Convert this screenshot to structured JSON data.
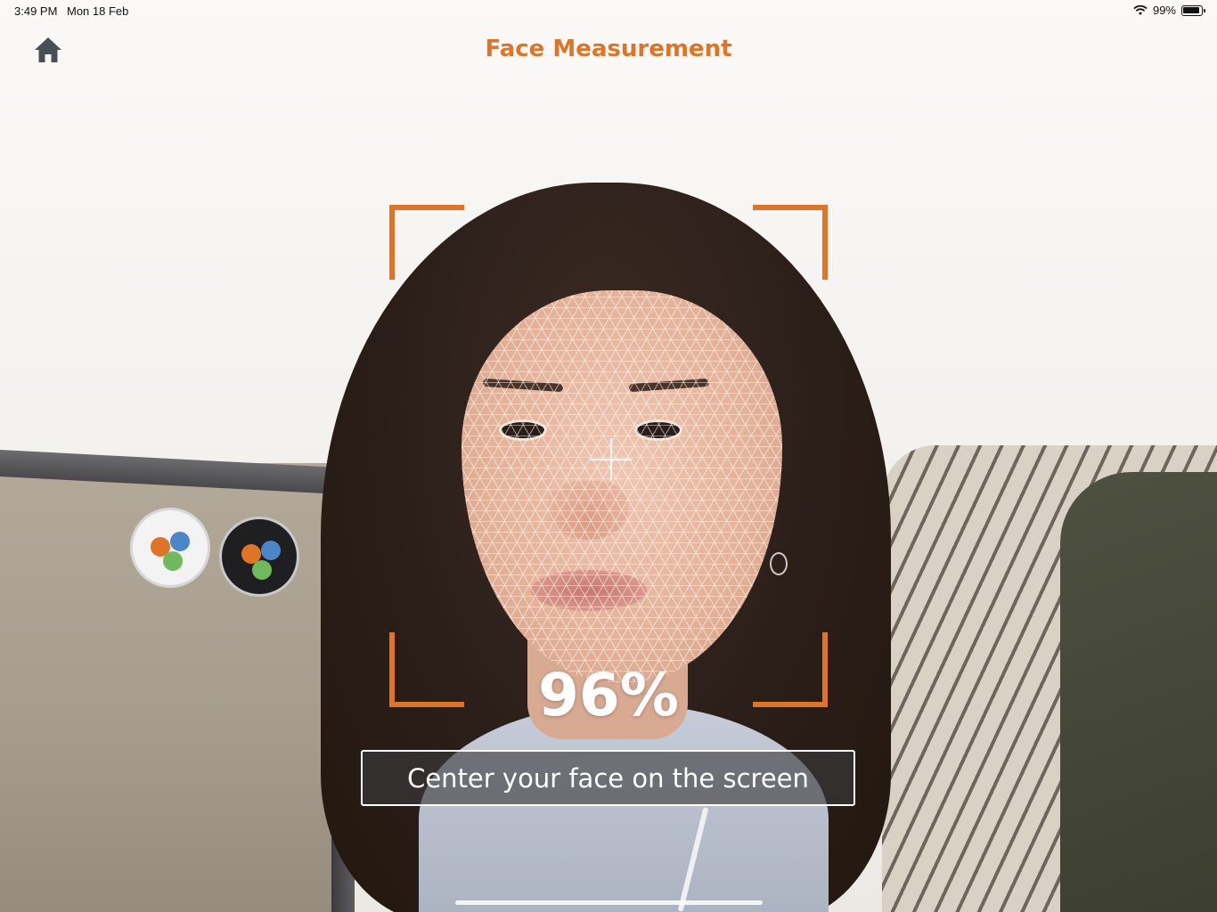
{
  "status_bar": {
    "time": "3:49 PM",
    "date": "Mon 18 Feb",
    "battery": "99%",
    "icons": [
      "wifi-icon",
      "battery-icon"
    ]
  },
  "header": {
    "title": "Face Measurement",
    "home_icon": "home-icon"
  },
  "scan": {
    "progress_text": "96%",
    "progress_value": 0.96,
    "instruction": "Center your face on the screen"
  },
  "colors": {
    "accent": "#e07426",
    "overlay_text": "#ffffff",
    "instruction_bg": "rgba(60,60,62,0.62)"
  }
}
